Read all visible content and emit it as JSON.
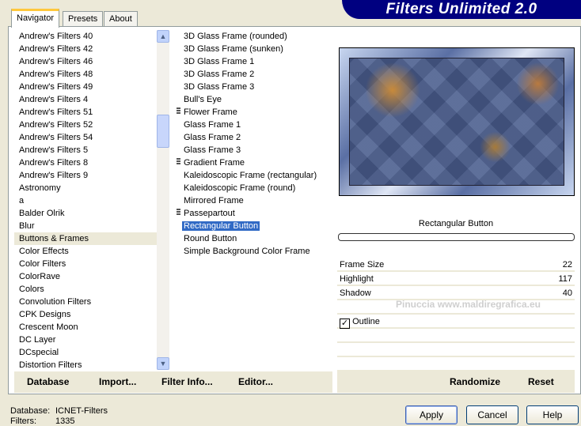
{
  "app": {
    "title": "Filters Unlimited 2.0"
  },
  "tabs": [
    "Navigator",
    "Presets",
    "About"
  ],
  "categories": [
    "Andrew's Filters 40",
    "Andrew's Filters 42",
    "Andrew's Filters 46",
    "Andrew's Filters 48",
    "Andrew's Filters 49",
    "Andrew's Filters 4",
    "Andrew's Filters 51",
    "Andrew's Filters 52",
    "Andrew's Filters 54",
    "Andrew's Filters 5",
    "Andrew's Filters 8",
    "Andrew's Filters 9",
    "Astronomy",
    "a",
    "Balder Olrik",
    "Blur",
    "Buttons & Frames",
    "Color Effects",
    "Color Filters",
    "ColorRave",
    "Colors",
    "Convolution Filters",
    "CPK Designs",
    "Crescent Moon",
    "DC Layer",
    "DCspecial",
    "Distortion Filters"
  ],
  "selected_category": "Buttons & Frames",
  "filters": [
    {
      "label": "3D Glass Frame (rounded)"
    },
    {
      "label": "3D Glass Frame (sunken)"
    },
    {
      "label": "3D Glass Frame 1"
    },
    {
      "label": "3D Glass Frame 2"
    },
    {
      "label": "3D Glass Frame 3"
    },
    {
      "label": "Bull's Eye"
    },
    {
      "label": "Flower Frame",
      "grip": true
    },
    {
      "label": "Glass Frame 1"
    },
    {
      "label": "Glass Frame 2"
    },
    {
      "label": "Glass Frame 3"
    },
    {
      "label": "Gradient Frame",
      "grip": true
    },
    {
      "label": "Kaleidoscopic Frame (rectangular)"
    },
    {
      "label": "Kaleidoscopic Frame (round)"
    },
    {
      "label": "Mirrored Frame"
    },
    {
      "label": "Passepartout",
      "grip": true
    },
    {
      "label": "Rectangular Button",
      "selected": true
    },
    {
      "label": "Round Button"
    },
    {
      "label": "Simple Background Color Frame"
    }
  ],
  "filter_name": "Rectangular Button",
  "params": [
    {
      "label": "Frame Size",
      "value": "22"
    },
    {
      "label": "Highlight",
      "value": "117"
    },
    {
      "label": "Shadow",
      "value": "40"
    }
  ],
  "outline": {
    "label": "Outline",
    "checked": true
  },
  "bottom_bar": {
    "database": "Database",
    "import": "Import...",
    "filter_info": "Filter Info...",
    "editor": "Editor...",
    "randomize": "Randomize",
    "reset": "Reset"
  },
  "status": {
    "database_label": "Database:",
    "database_value": "ICNET-Filters",
    "filters_label": "Filters:",
    "filters_value": "1335"
  },
  "buttons": {
    "apply": "Apply",
    "cancel": "Cancel",
    "help": "Help"
  },
  "watermark": "Pinuccia www.maldiregrafica.eu"
}
